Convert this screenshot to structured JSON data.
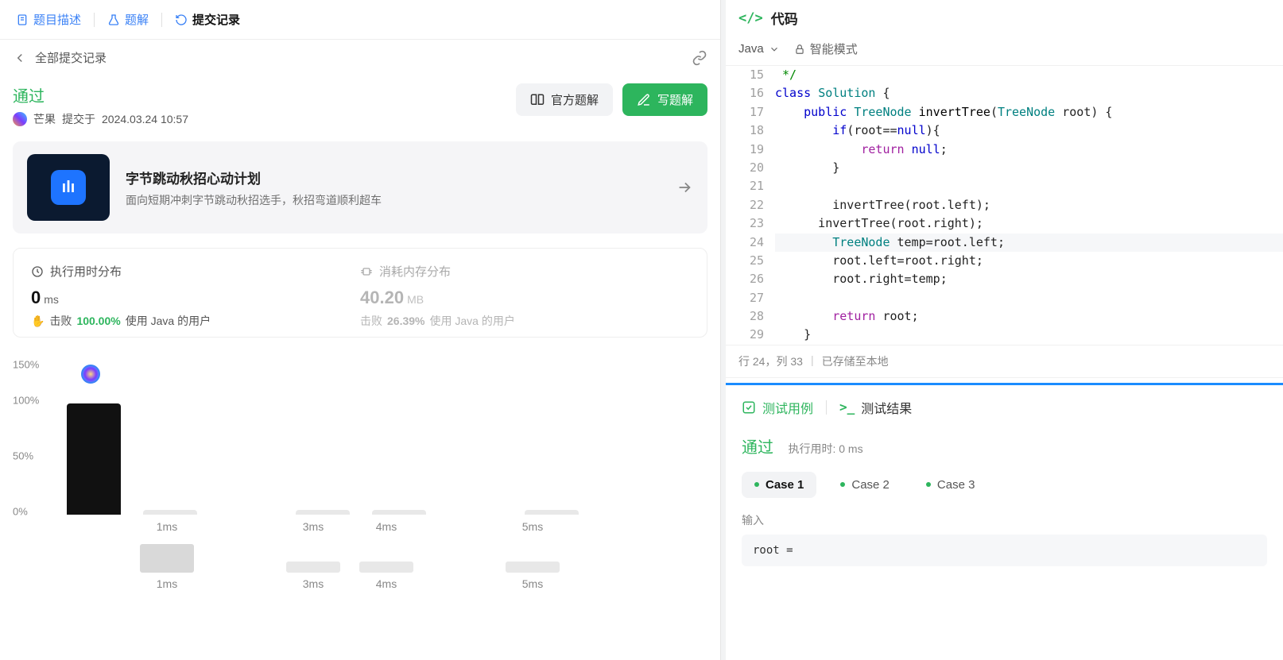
{
  "tabs": {
    "description": "题目描述",
    "solution": "题解",
    "submissions": "提交记录"
  },
  "back_label": "全部提交记录",
  "status": {
    "verdict": "通过",
    "author": "芒果",
    "submitted_prefix": "提交于",
    "submitted_at": "2024.03.24 10:57"
  },
  "actions": {
    "official_solution": "官方题解",
    "write_solution": "写题解"
  },
  "promo": {
    "title": "字节跳动秋招心动计划",
    "subtitle": "面向短期冲刺字节跳动秋招选手，秋招弯道顺利超车"
  },
  "stats": {
    "runtime_header": "执行用时分布",
    "memory_header": "消耗内存分布",
    "runtime_value": "0",
    "runtime_unit": "ms",
    "memory_value": "40.20",
    "memory_unit": "MB",
    "beat_label": "击败",
    "runtime_beat_pct": "100.00%",
    "memory_beat_pct": "26.39%",
    "beat_suffix": "使用 Java 的用户"
  },
  "chart_data": {
    "type": "bar",
    "ylabels": [
      "150%",
      "100%",
      "50%",
      "0%"
    ],
    "categories": [
      "",
      "1ms",
      "",
      "3ms",
      "4ms",
      "",
      "5ms"
    ],
    "values_pct": [
      100,
      2,
      0,
      2,
      2,
      0,
      2
    ],
    "marker_index": 0,
    "secondary_categories": [
      "",
      "1ms",
      "",
      "3ms",
      "4ms",
      "",
      "5ms"
    ],
    "secondary_heights": [
      0,
      36,
      0,
      14,
      14,
      0,
      14
    ]
  },
  "code_panel": {
    "title": "代码",
    "language": "Java",
    "mode": "智能模式"
  },
  "code_lines": [
    {
      "n": 15,
      "frags": [
        {
          "t": " */",
          "c": "com"
        }
      ]
    },
    {
      "n": 16,
      "frags": [
        {
          "t": "class ",
          "c": "kw"
        },
        {
          "t": "Solution",
          "c": "type"
        },
        {
          "t": " {"
        }
      ]
    },
    {
      "n": 17,
      "frags": [
        {
          "t": "    "
        },
        {
          "t": "public ",
          "c": "kw"
        },
        {
          "t": "TreeNode ",
          "c": "type"
        },
        {
          "t": "invertTree",
          "c": "fn"
        },
        {
          "t": "("
        },
        {
          "t": "TreeNode ",
          "c": "type"
        },
        {
          "t": "root) {"
        }
      ]
    },
    {
      "n": 18,
      "frags": [
        {
          "t": "        "
        },
        {
          "t": "if",
          "c": "kw"
        },
        {
          "t": "(root=="
        },
        {
          "t": "null",
          "c": "lit"
        },
        {
          "t": "){"
        }
      ]
    },
    {
      "n": 19,
      "frags": [
        {
          "t": "            "
        },
        {
          "t": "return ",
          "c": "ret"
        },
        {
          "t": "null",
          "c": "lit"
        },
        {
          "t": ";"
        }
      ]
    },
    {
      "n": 20,
      "frags": [
        {
          "t": "        }"
        }
      ]
    },
    {
      "n": 21,
      "frags": [
        {
          "t": ""
        }
      ]
    },
    {
      "n": 22,
      "frags": [
        {
          "t": "        invertTree(root.left);"
        }
      ]
    },
    {
      "n": 23,
      "frags": [
        {
          "t": "      invertTree(root.right);"
        }
      ]
    },
    {
      "n": 24,
      "hl": true,
      "frags": [
        {
          "t": "        "
        },
        {
          "t": "TreeNode ",
          "c": "type"
        },
        {
          "t": "temp=root.left;"
        }
      ]
    },
    {
      "n": 25,
      "frags": [
        {
          "t": "        root.left=root.right;"
        }
      ]
    },
    {
      "n": 26,
      "frags": [
        {
          "t": "        root.right=temp;"
        }
      ]
    },
    {
      "n": 27,
      "frags": [
        {
          "t": ""
        }
      ]
    },
    {
      "n": 28,
      "frags": [
        {
          "t": "        "
        },
        {
          "t": "return ",
          "c": "ret"
        },
        {
          "t": "root;"
        }
      ]
    },
    {
      "n": 29,
      "frags": [
        {
          "t": "    }"
        }
      ]
    }
  ],
  "status_bar": {
    "cursor": "行 24，列 33",
    "saved": "已存储至本地"
  },
  "test_panel": {
    "tab_cases": "测试用例",
    "tab_results": "测试结果",
    "verdict": "通过",
    "runtime_label": "执行用时: 0 ms",
    "cases": [
      "Case 1",
      "Case 2",
      "Case 3"
    ],
    "active_case": 0,
    "input_label": "输入",
    "input_value": "root ="
  }
}
